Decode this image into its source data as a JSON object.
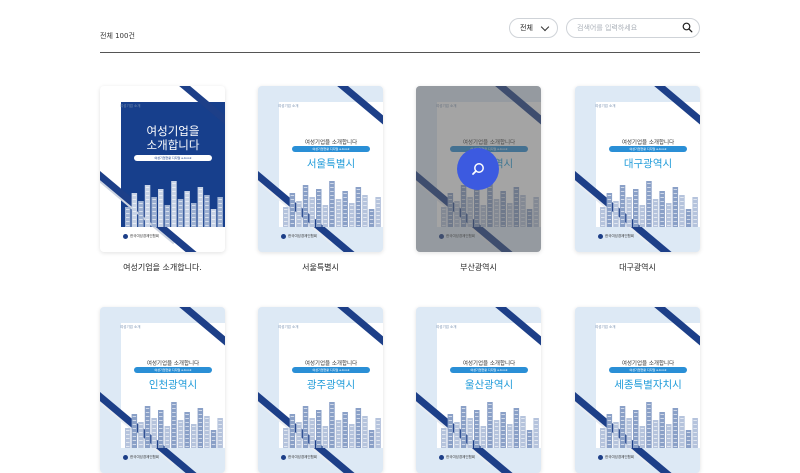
{
  "header": {
    "total": "전체 100건",
    "filter": {
      "selected": "전체"
    },
    "search": {
      "placeholder": "검색어를 입력하세요",
      "value": ""
    }
  },
  "cards": [
    {
      "caption": "여성기업을 소개합니다.",
      "cover_title": "여성기업을 소개합니다",
      "pill": "여성기업현황 디지털 e-book",
      "region": ""
    },
    {
      "caption": "서울특별시",
      "cover_title": "여성기업을 소개합니다",
      "pill": "여성기업현황 디지털 e-book",
      "region": "서울특별시"
    },
    {
      "caption": "부산광역시",
      "cover_title": "여성기업을 소개합니다",
      "pill": "여성기업현황 디지털 e-book",
      "region": "부산광역시"
    },
    {
      "caption": "대구광역시",
      "cover_title": "여성기업을 소개합니다",
      "pill": "여성기업현황 디지털 e-book",
      "region": "대구광역시"
    },
    {
      "caption": "인천광역시",
      "cover_title": "여성기업을 소개합니다",
      "pill": "여성기업현황 디지털 e-book",
      "region": "인천광역시"
    },
    {
      "caption": "광주광역시",
      "cover_title": "여성기업을 소개합니다",
      "pill": "여성기업현황 디지털 e-book",
      "region": "광주광역시"
    },
    {
      "caption": "울산광역시",
      "cover_title": "여성기업을 소개합니다",
      "pill": "여성기업현황 디지털 e-book",
      "region": "울산광역시"
    },
    {
      "caption": "세종특별자치시",
      "cover_title": "여성기업을 소개합니다",
      "pill": "여성기업현황 디지털 e-book",
      "region": "세종특별자치시"
    }
  ],
  "cover_publisher": "여성기업 소개",
  "cover_logo": "한국여성경제인협회",
  "colors": {
    "navy": "#1d3f88",
    "cover_bg": "#dde9f5",
    "region_text": "#1f9bd9",
    "zoom_button": "#3c5ae0"
  },
  "icons": {
    "search": "search-icon",
    "filter_chevron": "chevron-down-icon",
    "hover_zoom": "zoom-icon"
  }
}
